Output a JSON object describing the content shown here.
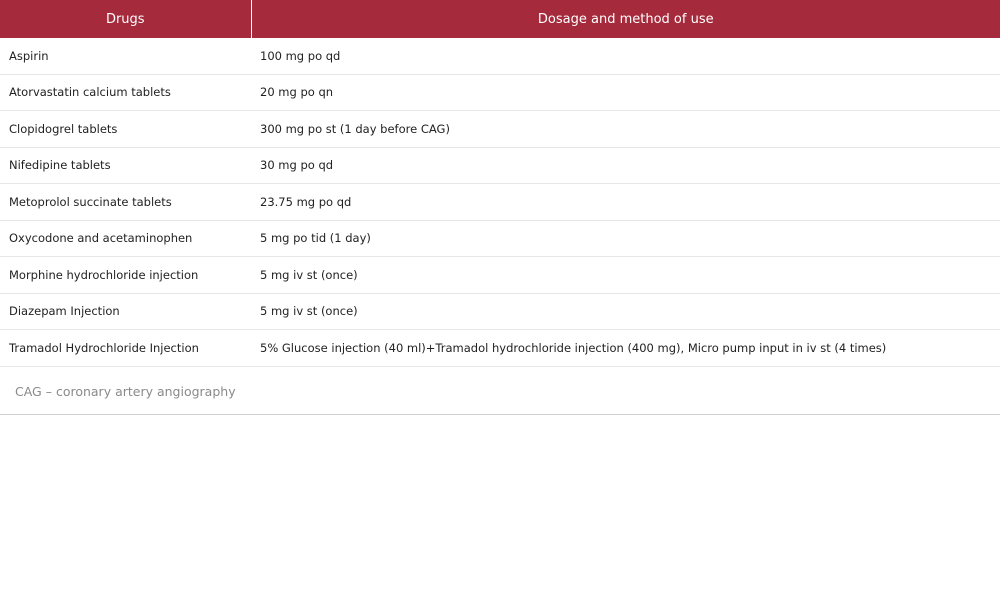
{
  "header": {
    "col1": "Drugs",
    "col2": "Dosage and method of use"
  },
  "rows": [
    {
      "drug": "Aspirin",
      "dosage": "100 mg po qd"
    },
    {
      "drug": "Atorvastatin calcium tablets",
      "dosage": "20 mg po qn"
    },
    {
      "drug": "Clopidogrel tablets",
      "dosage": "300 mg po st (1 day before CAG)"
    },
    {
      "drug": "Nifedipine tablets",
      "dosage": "30 mg po qd"
    },
    {
      "drug": "Metoprolol succinate tablets",
      "dosage": "23.75 mg po qd"
    },
    {
      "drug": "Oxycodone and acetaminophen",
      "dosage": "5 mg po tid (1 day)"
    },
    {
      "drug": "Morphine hydrochloride injection",
      "dosage": "5 mg iv st (once)"
    },
    {
      "drug": "Diazepam Injection",
      "dosage": "5 mg iv st (once)"
    },
    {
      "drug": "Tramadol Hydrochloride Injection",
      "dosage": "5% Glucose injection (40 ml)+Tramadol hydrochloride injection (400 mg), Micro pump input in iv st (4 times)"
    }
  ],
  "footnote": "CAG – coronary artery angiography",
  "colors": {
    "header_bg": "#a52a3c",
    "header_text": "#ffffff",
    "row_divider": "#e6e6e6",
    "footnote_text": "#8a8a8a"
  }
}
